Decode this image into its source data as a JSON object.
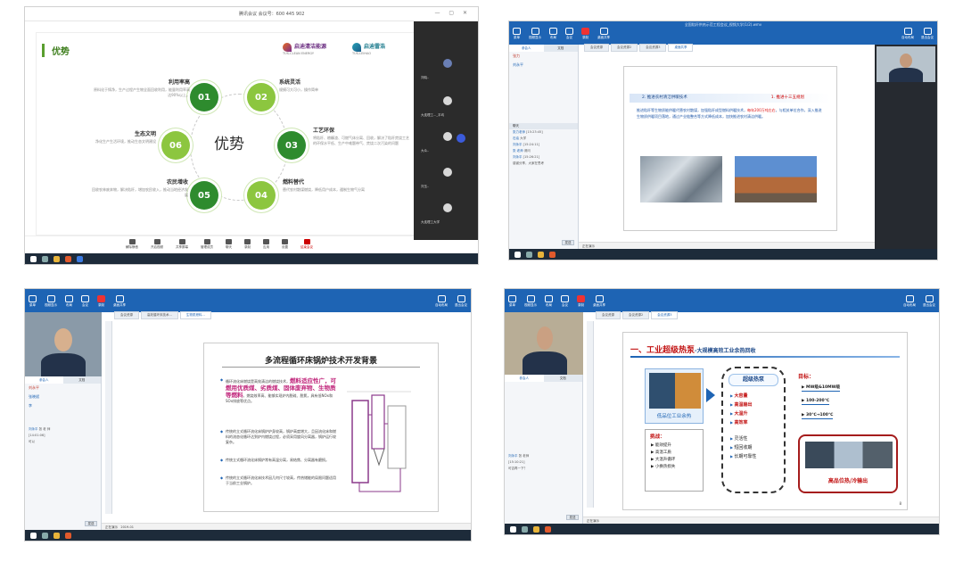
{
  "screen1": {
    "meeting_id": "腾讯会议  会议号：600 445 902",
    "slide_title": "优势",
    "logo_left": "启迪清洁能源",
    "logo_left_sub": "TUS-CLEAN ENERGY",
    "logo_right": "启迪雷浩",
    "logo_right_sub": "TUS-LEIHAO",
    "center_word": "优势",
    "nodes": [
      "01",
      "02",
      "03",
      "04",
      "05",
      "06"
    ],
    "advantages": [
      {
        "title": "利用率高",
        "desc": "原料化于铸净，生产过程产生物全面回收利用，能量利用率高达90%以上。"
      },
      {
        "title": "系统灵活",
        "desc": "规模可大可小，操作简单"
      },
      {
        "title": "工艺环保",
        "desc": "将秸秆、粮糠渣、可燃气体分离、回收，解决了秸秆焚烧工艺的环保水平低、生产中难题带气、焚烧二次污染的问题"
      },
      {
        "title": "燃料替代",
        "desc": "替代农村散煤燃烧，降低用户成本，遏制生物气分离"
      },
      {
        "title": "农民增收",
        "desc": "回收农林废弃物，解决秸秆，增加农民收入，推动当地经济发展"
      },
      {
        "title": "生态文明",
        "desc": "净化生产生活环境，推动生态文明建设"
      }
    ],
    "participants": [
      "刘晓..",
      "大连理工..._平均",
      "大众..",
      "刘玉..",
      "大连理工大学"
    ],
    "toolbar": [
      "解除静音",
      "开启视频",
      "共享屏幕",
      "管理成员",
      "聊天",
      "录制",
      "应用",
      "设置",
      "结束会议"
    ]
  },
  "screen2": {
    "title": "全国秸秆供热示范工程会议_视频大学(1/2).wmv",
    "tools": [
      "菜单",
      "视频显示",
      "布局",
      "会议",
      "录制",
      "桌面共享"
    ],
    "tools_right": [
      "自动布局",
      "退出会议"
    ],
    "tabs": [
      "参会人",
      "文档"
    ],
    "people": [
      "张力",
      "刘永平"
    ],
    "doc_tabs": [
      "会议资源",
      "会议资源2",
      "会议资源3",
      "桌面共享"
    ],
    "slide_head": "2. 推进农村清洁供暖技术",
    "slide_tag": "1. 推进十三五规划",
    "slide_text_1": "推进秸秆等生物质能供暖代替农村散煤，加强秸秆成型燃料供暖技术，",
    "slide_text_red": "每年200万吨左右",
    "slide_text_2": "，与相关单位合作，深入推进生物质供暖项目落地，通过产业链整合等方式降低成本，加快推进农村清洁供暖。",
    "chat_title": "聊天",
    "chat": [
      {
        "who": "张力老师",
        "text": "[15:23:45]"
      },
      {
        "who": "石油",
        "text": "大学"
      },
      {
        "who": "刘永平",
        "text": "[15:24:11]"
      },
      {
        "who": "张 老师",
        "text": "请问"
      },
      {
        "who": "刘永平",
        "text": "[15:26:21]"
      },
      {
        "who": "",
        "text": "感谢分享，大家在思考"
      }
    ],
    "send": "发送",
    "status": "正在演示"
  },
  "screen3": {
    "tools": [
      "菜单",
      "视频显示",
      "布局",
      "会议",
      "录制",
      "桌面共享"
    ],
    "tools_right": [
      "自动布局",
      "退出会议"
    ],
    "tabs": [
      "参会人",
      "文档"
    ],
    "people": [
      "刘永平",
      "张晓斌",
      "李"
    ],
    "doc_tabs": [
      "会议资源",
      "高效循环床技术...",
      "生物质燃料..."
    ],
    "slide_title": "多流程循环床锅炉技术开发背景",
    "b1_plain": "循环流化床燃烧是高效清洁的燃烧技术，",
    "b1_hl": "燃料适应性广，可燃用优质煤、劣质煤、固体废弃物、生物质等燃料",
    "b1_tail": "。燃烧效率高、能够实现炉内脱硫、脱氮，具有低NOx和SOx排放等优点。",
    "b2": "传统的立式循环流化床锅炉炉身较高，锅炉高度增大，且因流化床和燃料的流态化循环达到炉内燃烧过程，必须采用旋风分离器，锅炉运行较复杂。",
    "b3": "传统立式循环流化床锅炉常有高温分离，易结焦、分离器有磨损。",
    "b4": "传统的立式循环流化床技术因几何尺寸较高，传热储能的局限问题适用于当前工业锅炉。",
    "chat": [
      {
        "who": "刘永平",
        "text": "张 老 师"
      },
      {
        "who": "",
        "text": "[14:01:06]"
      },
      {
        "who": "",
        "text": "可以"
      }
    ],
    "send": "发送",
    "status": "正在演示",
    "page": "2019-01"
  },
  "screen4": {
    "tools": [
      "菜单",
      "视频显示",
      "布局",
      "会议",
      "录制",
      "桌面共享"
    ],
    "tools_right": [
      "自动布局",
      "退出会议"
    ],
    "tabs": [
      "参会人",
      "文档"
    ],
    "doc_tabs": [
      "会议资源",
      "会议资源2",
      "会议资源3"
    ],
    "slide_head": "一、工业超级热泵",
    "slide_head_sub": "-大规模高效工业余热回收",
    "low_heat": "低品位工业余热",
    "challenge_title": "挑战：",
    "challenges": [
      "能效提升",
      "高温工质",
      "大温升循环",
      "小换热损失"
    ],
    "center_title": "超级热泵",
    "center_red": [
      "大容量",
      "高温输出",
      "大温升",
      "高效率"
    ],
    "center_black": [
      "灵活性",
      "短回收期",
      "长期可靠性"
    ],
    "goal_title": "目标：",
    "goals": [
      "MW级&10MW级",
      "100-200℃",
      "30℃→100℃"
    ],
    "output": "高品位热/冷输出",
    "chat": [
      {
        "who": "刘永平",
        "text": "张 老师"
      },
      {
        "who": "",
        "text": "[15:10:21]"
      },
      {
        "who": "",
        "text": "可否再一下？"
      }
    ],
    "send": "发送",
    "status": "正在演示",
    "page_no": "8"
  }
}
